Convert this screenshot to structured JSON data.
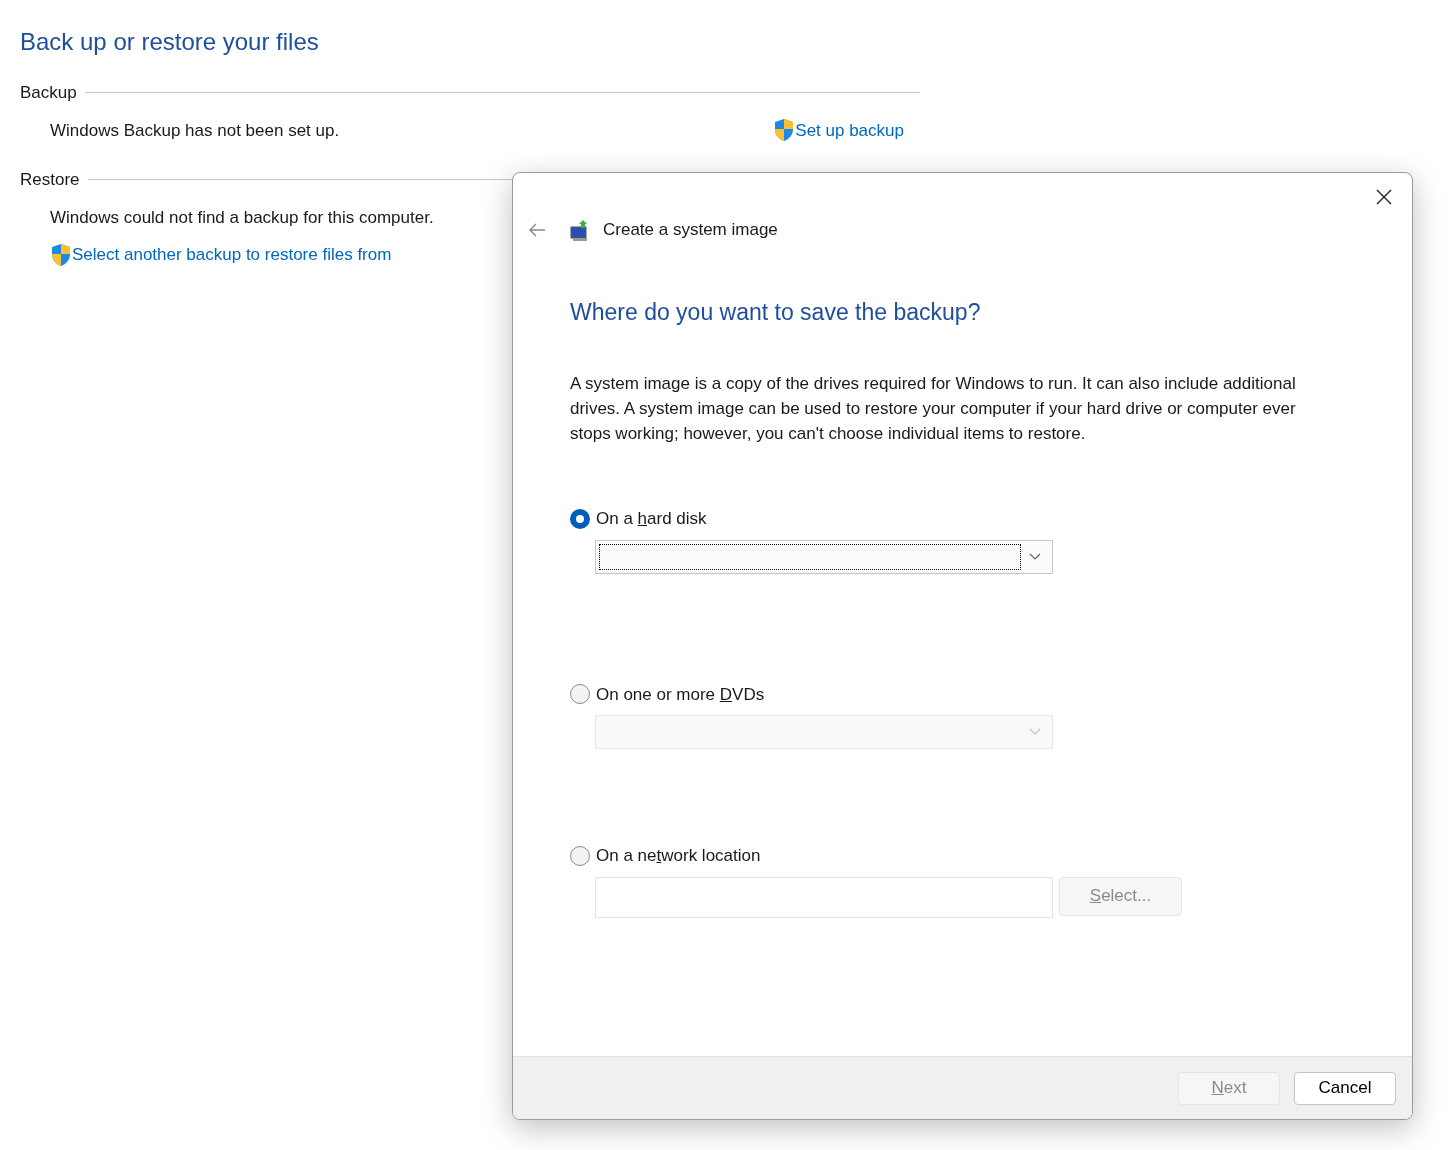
{
  "page": {
    "title": "Back up or restore your files",
    "sections": [
      {
        "heading": "Backup",
        "status": "Windows Backup has not been set up.",
        "link": {
          "label": "Set up backup"
        }
      },
      {
        "heading": "Restore",
        "status": "Windows could not find a backup for this computer.",
        "link": {
          "label": "Select another backup to restore files from"
        }
      }
    ]
  },
  "dialog": {
    "title": "Create a system image",
    "heading": "Where do you want to save the backup?",
    "description": "A system image is a copy of the drives required for Windows to run. It can also include additional drives. A system image can be used to restore your computer if your hard drive or computer ever stops working; however, you can't choose individual items to restore.",
    "options": [
      {
        "kind": "dropdown",
        "selected": true,
        "label": {
          "pre": "On a ",
          "key": "h",
          "post": "ard disk"
        },
        "disabled": false,
        "focused": true
      },
      {
        "kind": "dropdown",
        "selected": false,
        "label": {
          "pre": "On one or more ",
          "key": "D",
          "post": "VDs"
        },
        "disabled": true,
        "focused": false
      },
      {
        "kind": "path",
        "selected": false,
        "label": {
          "pre": "On a ne",
          "key": "t",
          "post": "work location"
        },
        "button": {
          "key": "S",
          "post": "elect...",
          "disabled": true
        }
      }
    ],
    "buttons": [
      {
        "key": "N",
        "post": "ext",
        "disabled": true
      },
      {
        "pre": "Cancel",
        "disabled": false
      }
    ]
  }
}
